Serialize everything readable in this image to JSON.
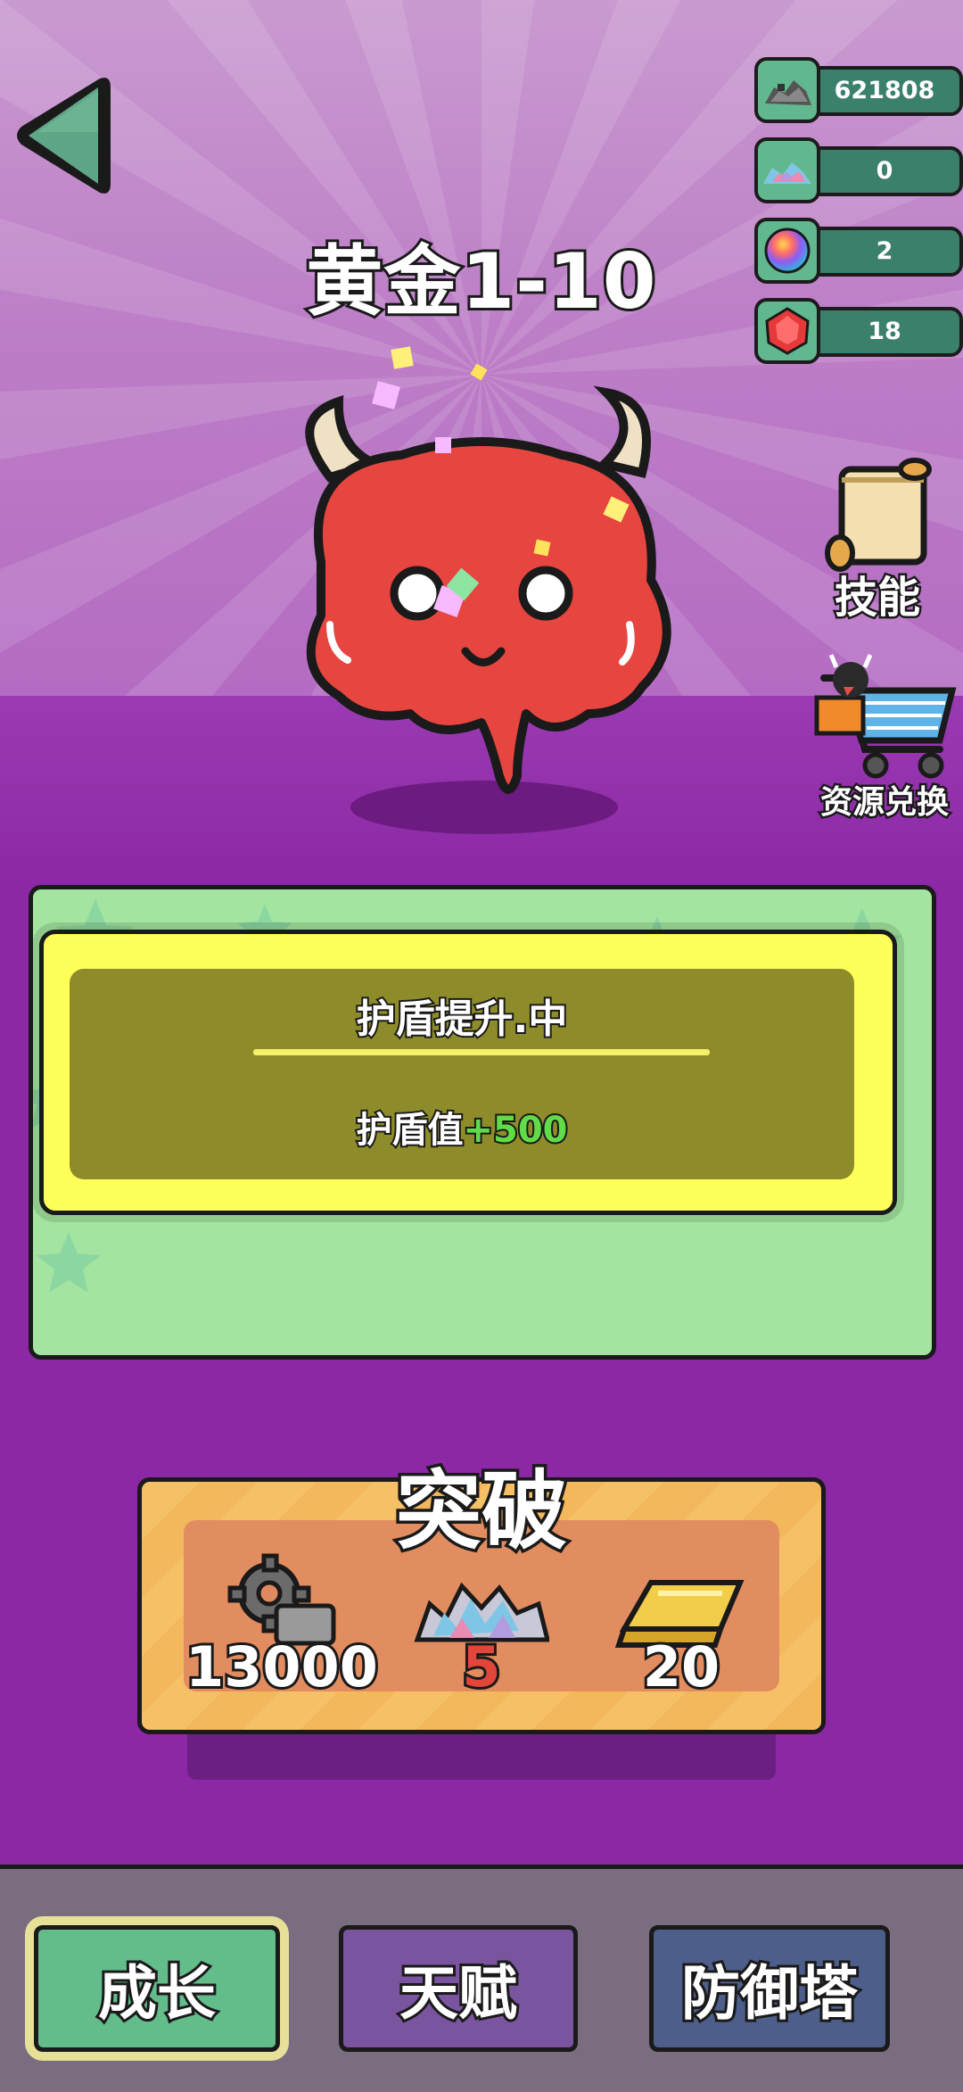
{
  "stage_title": "黄金1-10",
  "resources": [
    {
      "name": "scrap-metal-icon",
      "value": "621808"
    },
    {
      "name": "crystal-pile-icon",
      "value": "0"
    },
    {
      "name": "rainbow-orb-icon",
      "value": "2"
    },
    {
      "name": "red-gem-icon",
      "value": "18"
    }
  ],
  "side_buttons": {
    "skills_label": "技能",
    "exchange_label": "资源兑换"
  },
  "skill_card": {
    "name": "护盾提升.中",
    "desc_prefix": "护盾值",
    "desc_bonus": "+500"
  },
  "breakthrough": {
    "title": "突破",
    "costs": [
      {
        "icon": "gear-scrap-icon",
        "amount": "13000",
        "sufficient": true
      },
      {
        "icon": "crystal-pile-icon",
        "amount": "5",
        "sufficient": false
      },
      {
        "icon": "gold-bar-icon",
        "amount": "20",
        "sufficient": true
      }
    ]
  },
  "tabs": [
    {
      "label": "成长",
      "active": true
    },
    {
      "label": "天赋",
      "active": false
    },
    {
      "label": "防御塔",
      "active": false
    }
  ],
  "colors": {
    "accent_green": "#62bd8b",
    "bonus_green": "#5fdc47",
    "insufficient_red": "#e2463b",
    "card_yellow": "#ffff5a"
  }
}
